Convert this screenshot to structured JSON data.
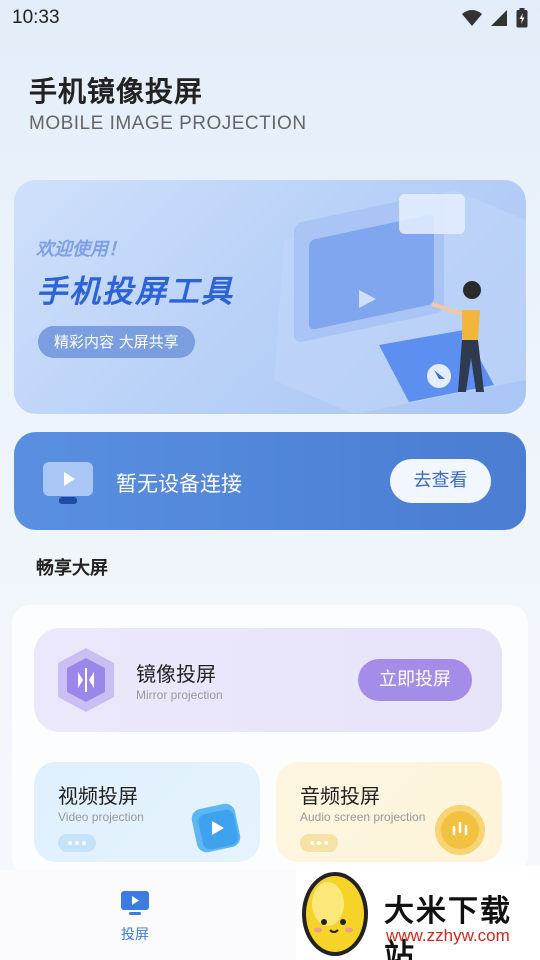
{
  "status_bar": {
    "time": "10:33"
  },
  "header": {
    "title": "手机镜像投屏",
    "subtitle": "MOBILE IMAGE PROJECTION"
  },
  "banner": {
    "welcome": "欢迎使用！",
    "title": "手机投屏工具",
    "pill": "精彩内容 大屏共享"
  },
  "device": {
    "status": "暂无设备连接",
    "button": "去查看"
  },
  "section": {
    "title": "畅享大屏"
  },
  "mirror": {
    "title": "镜像投屏",
    "subtitle": "Mirror projection",
    "button": "立即投屏"
  },
  "video": {
    "title": "视频投屏",
    "subtitle": "Video projection"
  },
  "audio": {
    "title": "音频投屏",
    "subtitle": "Audio screen projection"
  },
  "bottom_nav": {
    "tabs": [
      {
        "label": "投屏",
        "icon": "screen-cast-icon",
        "active": true
      }
    ]
  },
  "watermark": {
    "text": "大米下载站",
    "url": "www.zzhyw.com"
  },
  "colors": {
    "accent": "#3c7be0",
    "purple": "#a48de9",
    "card_blue": "#4f84d8"
  }
}
